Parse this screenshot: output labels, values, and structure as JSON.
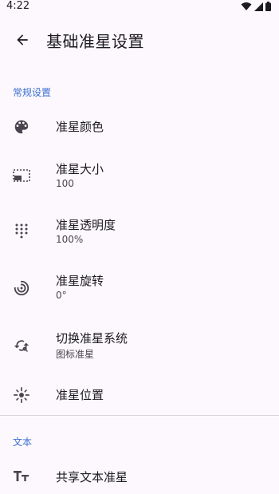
{
  "status": {
    "time": "4:22"
  },
  "header": {
    "title": "基础准星设置"
  },
  "sections": [
    {
      "title": "常规设置",
      "items": [
        {
          "title": "准星颜色",
          "subtitle": "",
          "icon": "palette-icon"
        },
        {
          "title": "准星大小",
          "subtitle": "100",
          "icon": "resize-icon"
        },
        {
          "title": "准星透明度",
          "subtitle": "100%",
          "icon": "opacity-dots-icon"
        },
        {
          "title": "准星旋转",
          "subtitle": "0°",
          "icon": "rotate-icon"
        },
        {
          "title": "切换准星系统",
          "subtitle": "图标准星",
          "icon": "switch-icon"
        },
        {
          "title": "准星位置",
          "subtitle": "",
          "icon": "position-icon"
        }
      ]
    },
    {
      "title": "文本",
      "items": [
        {
          "title": "共享文本准星",
          "subtitle": "",
          "icon": "text-icon"
        }
      ]
    }
  ],
  "colors": {
    "accent": "#3a6fd1",
    "background": "#fdf8fd",
    "text": "#1c1b1f"
  }
}
